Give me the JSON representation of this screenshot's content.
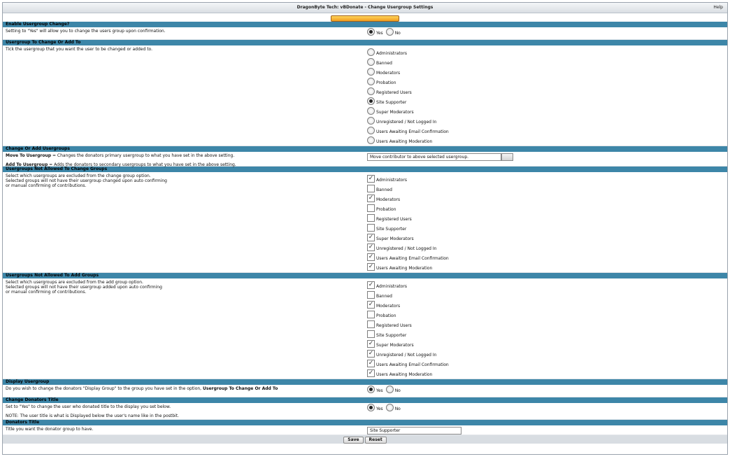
{
  "window": {
    "title": "DragonByte Tech: vBDonate - Change Usergroup Settings",
    "help": "Help"
  },
  "sections": {
    "enable": {
      "header": "Enable Usergroup Change?",
      "description": "Setting to \"Yes\" will allow you to change the users group upon confirmation.",
      "yes": "Yes",
      "no": "No",
      "selected": "Yes"
    },
    "change_to": {
      "header": "Usergroup To Change Or Add To",
      "description": "Tick the usergroup that you want the user to be changed or added to.",
      "options": [
        "Administrators",
        "Banned",
        "Moderators",
        "Probation",
        "Registered Users",
        "Site Supporter",
        "Super Moderators",
        "Unregistered / Not Logged In",
        "Users Awaiting Email Confirmation",
        "Users Awaiting Moderation"
      ],
      "selected": "Site Supporter"
    },
    "change_or_add": {
      "header": "Change Or Add Usergroups",
      "move_label": "Move To Usergroup",
      "move_desc": " = Changes the donators primary usergroup to what you have set in the above setting.",
      "add_label": "Add To Usergroup",
      "add_desc": " = Adds the donators to secondary usergroups to what you have set in the above setting.",
      "select_value": "Move contributor to above selected usergroup."
    },
    "not_change": {
      "header": "Usergroups Not Allowed To Change Groups",
      "desc1": "Select which usergroups are excluded from the change group option.",
      "desc2": "Selected groups will not have their usergroup changed upon auto confirming",
      "desc3": "or manual confirming of contributions.",
      "options": [
        {
          "label": "Administrators",
          "checked": true
        },
        {
          "label": "Banned",
          "checked": false
        },
        {
          "label": "Moderators",
          "checked": true
        },
        {
          "label": "Probation",
          "checked": false
        },
        {
          "label": "Registered Users",
          "checked": false
        },
        {
          "label": "Site Supporter",
          "checked": false
        },
        {
          "label": "Super Moderators",
          "checked": true
        },
        {
          "label": "Unregistered / Not Logged In",
          "checked": true
        },
        {
          "label": "Users Awaiting Email Confirmation",
          "checked": true
        },
        {
          "label": "Users Awaiting Moderation",
          "checked": true
        }
      ]
    },
    "not_add": {
      "header": "Usergroups Not Allowed To Add Groups",
      "desc1": "Select which usergroups are excluded from the add group option.",
      "desc2": "Selected groups will not have their usergroup added upon auto confirming",
      "desc3": "or manual confirming of contributions.",
      "options": [
        {
          "label": "Administrators",
          "checked": true
        },
        {
          "label": "Banned",
          "checked": false
        },
        {
          "label": "Moderators",
          "checked": true
        },
        {
          "label": "Probation",
          "checked": false
        },
        {
          "label": "Registered Users",
          "checked": false
        },
        {
          "label": "Site Supporter",
          "checked": false
        },
        {
          "label": "Super Moderators",
          "checked": true
        },
        {
          "label": "Unregistered / Not Logged In",
          "checked": true
        },
        {
          "label": "Users Awaiting Email Confirmation",
          "checked": true
        },
        {
          "label": "Users Awaiting Moderation",
          "checked": true
        }
      ]
    },
    "display": {
      "header": "Display Usergroup",
      "desc_pre": "Do you wish to change the donators \"Display Group\" to the group you have set in the option, ",
      "desc_bold": "Usergroup To Change Or Add To",
      "yes": "Yes",
      "no": "No",
      "selected": "Yes"
    },
    "title_change": {
      "header": "Change Donators Title",
      "desc": "Set to \"Yes\" to change the user who donated title to the display you set below.",
      "note": "NOTE: The user title is what is Displayed below the user's name like in the postbit.",
      "yes": "Yes",
      "no": "No",
      "selected": "Yes"
    },
    "donator_title": {
      "header": "Donators Title",
      "desc": "Title you want the donator group to have.",
      "value": "Site Supporter"
    }
  },
  "footer": {
    "save": "Save",
    "reset": "Reset"
  }
}
